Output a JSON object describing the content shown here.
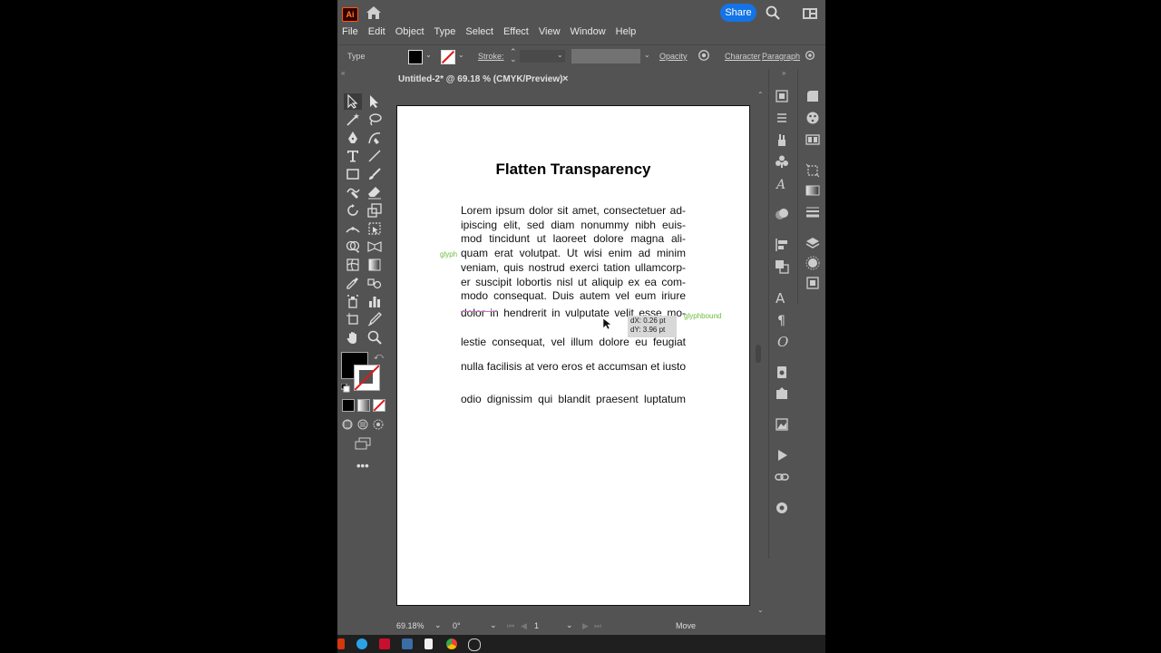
{
  "app": {
    "logo": "Ai",
    "share_label": "Share",
    "menus": [
      "File",
      "Edit",
      "Object",
      "Type",
      "Select",
      "Effect",
      "View",
      "Window",
      "Help"
    ]
  },
  "control": {
    "type_label": "Type",
    "stroke_label": "Stroke:",
    "opacity_label": "Opacity",
    "character_label": "Character",
    "paragraph_label": "Paragraph"
  },
  "document": {
    "tab_title": "Untitled-2* @ 69.18 % (CMYK/Preview)",
    "close": "×",
    "title": "Flatten Transparency",
    "lines": [
      "Lorem ipsum dolor sit amet, consectetuer ad-",
      "ipiscing elit, sed diam nonummy nibh euis-",
      "mod tincidunt ut laoreet dolore magna ali-",
      "quam erat volutpat. Ut wisi enim ad minim",
      "veniam, quis nostrud exerci tation ullamcorp-",
      "er suscipit lobortis nisl ut aliquip ex ea com-",
      "modo consequat. Duis autem vel eum iriure",
      "dolor in hendrerit in vulputate velit esse mo-"
    ],
    "line9": "lestie consequat, vel illum dolore eu feugiat",
    "line10": "nulla facilisis at vero eros et accumsan et iusto",
    "line11": "odio dignissim qui blandit praesent luptatum",
    "glyph_label": "glyphbound",
    "glyph_label_short": "glyph",
    "tooltip_dx": "dX: 0.26 pt",
    "tooltip_dy": "dY: 3.96 pt"
  },
  "status": {
    "zoom": "69.18%",
    "rotation": "0°",
    "artboard": "1",
    "tool": "Move"
  },
  "colors": {
    "accent": "#1473e6",
    "ui_bg": "#535353",
    "guide_green": "#6dbb3c"
  }
}
